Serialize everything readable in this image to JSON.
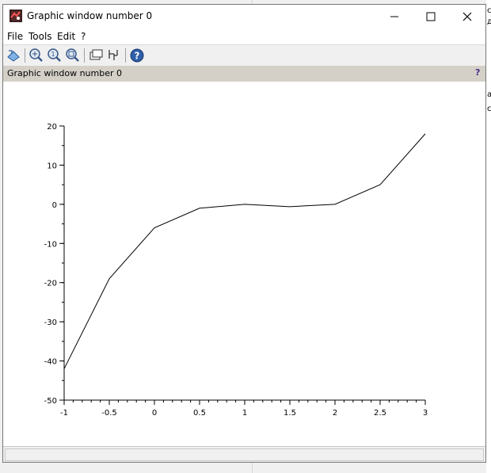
{
  "window": {
    "title": "Graphic window number 0",
    "minimize_icon": "minimize-icon",
    "maximize_icon": "maximize-icon",
    "close_icon": "close-icon"
  },
  "menu": [
    "File",
    "Tools",
    "Edit",
    "?"
  ],
  "toolbar": [
    {
      "name": "rotate-icon"
    },
    {
      "name": "zoom-icon"
    },
    {
      "name": "unzoom-icon"
    },
    {
      "name": "zoom-area-icon"
    },
    {
      "name": "datatip-icon"
    },
    {
      "name": "datatip-manager-icon"
    },
    {
      "name": "help-icon"
    }
  ],
  "infobar": {
    "text": "Graphic window number 0",
    "help": "?"
  },
  "background_text": [
    "c",
    "д",
    "аа",
    "с"
  ],
  "chart_data": {
    "type": "line",
    "x": [
      -1,
      -0.5,
      0,
      0.5,
      1,
      1.5,
      2,
      2.5,
      3
    ],
    "y": [
      -42,
      -19,
      -6,
      -1,
      0,
      -0.6,
      0,
      5,
      18
    ],
    "xlim": [
      -1,
      3
    ],
    "ylim": [
      -50,
      20
    ],
    "xticks": [
      "-1",
      "-0.5",
      "0",
      "0.5",
      "1",
      "1.5",
      "2",
      "2.5",
      "3"
    ],
    "yticks": [
      "20",
      "10",
      "0",
      "-10",
      "-20",
      "-30",
      "-40",
      "-50"
    ],
    "grid": false,
    "line_color": "#000000"
  }
}
